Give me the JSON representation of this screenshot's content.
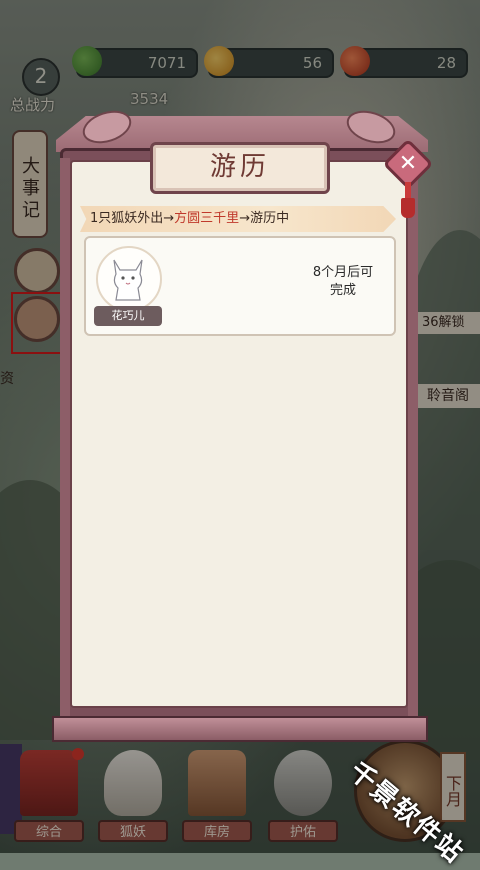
{
  "resources": [
    {
      "name": "green-gem",
      "value": "7071"
    },
    {
      "name": "gold-coin",
      "value": "56"
    },
    {
      "name": "red-fruit",
      "value": "28"
    }
  ],
  "player": {
    "level": "2",
    "power_label": "总战力",
    "power_value": "3534"
  },
  "side": {
    "events_label": "大事记",
    "unlock_text": "36解锁",
    "pavilion": "聆音阁",
    "edge_char": "资"
  },
  "modal": {
    "title": "游历",
    "status": {
      "prefix": "1只狐妖外出→",
      "place": "方圆三千里",
      "suffix": "→游历中"
    },
    "cards": [
      {
        "name": "花巧儿",
        "time_line1": "8个月后可",
        "time_line2": "完成"
      }
    ]
  },
  "nav": [
    {
      "label": "综合"
    },
    {
      "label": "狐妖"
    },
    {
      "label": "库房"
    },
    {
      "label": "护佑"
    }
  ],
  "down_tag": "下月",
  "watermark": "千景软件站"
}
